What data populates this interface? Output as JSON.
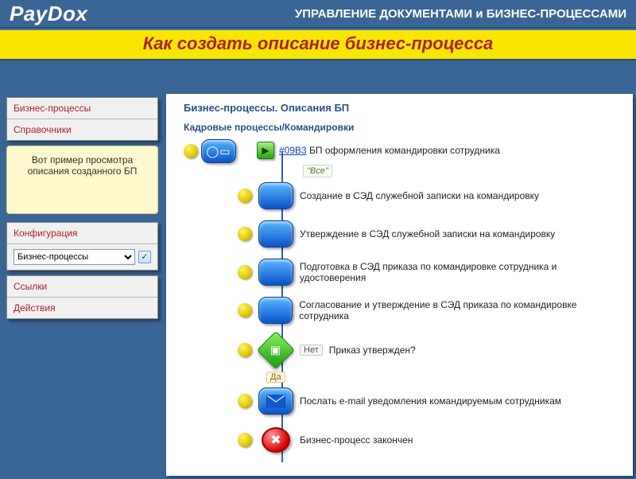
{
  "header": {
    "logo": "PayDox",
    "subtitle": "УПРАВЛЕНИЕ ДОКУМЕНТАМИ и БИЗНЕС-ПРОЦЕССАМИ",
    "banner": "Как создать описание бизнес-процесса"
  },
  "sidebar": {
    "group1": [
      "Бизнес-процессы",
      "Справочники"
    ],
    "callout": "Вот пример просмотра описания созданного БП",
    "config_label": "Конфигурация",
    "config_select": "Бизнес-процессы",
    "group3": [
      "Ссылки",
      "Действия"
    ]
  },
  "main": {
    "crumb": "Бизнес-процессы. Описания БП",
    "subcrumb": "Кадровые процессы/Командировки",
    "start_ref": "#09B3",
    "start_text": " БП оформления командировки сотрудника",
    "group_label": "\"Все\"",
    "steps": [
      "Создание в СЭД служебной записки на командировку",
      "Утверждение в СЭД служебной записки на командировку",
      "Подготовка в СЭД приказа по командировке сотрудника и удостоверения",
      "Согласование и утверждение в СЭД приказа по командировке сотрудника"
    ],
    "decision": "Приказ утвержден?",
    "decision_no": "Нет",
    "decision_yes": "Да",
    "mail_step": "Послать e-mail уведомления командируемым сотрудникам",
    "end_step": "Бизнес-процесс закончен"
  }
}
